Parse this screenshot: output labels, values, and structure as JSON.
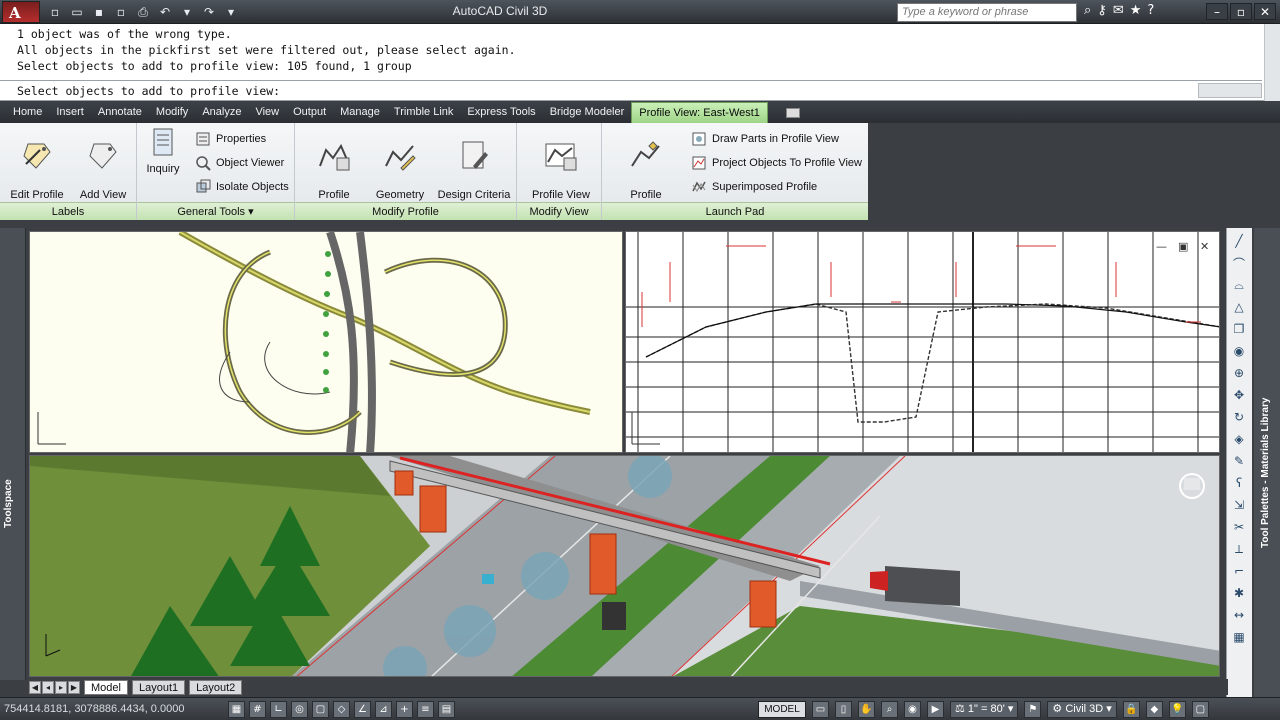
{
  "app": {
    "title": "AutoCAD Civil 3D",
    "logo_letter": "A",
    "search_placeholder": "Type a keyword or phrase"
  },
  "command_line": {
    "history": [
      "1 object was of the wrong type.",
      "All objects in the pickfirst set were filtered out, please select again.",
      "Select objects to add to profile view: 105 found, 1 group"
    ],
    "prompt": "Select objects to add to profile view:"
  },
  "ribbon": {
    "tabs": [
      "Home",
      "Insert",
      "Annotate",
      "Modify",
      "Analyze",
      "View",
      "Output",
      "Manage",
      "Trimble Link",
      "Express Tools",
      "Bridge Modeler",
      "Profile View: East-West1"
    ],
    "active_tab": "Profile View: East-West1",
    "panels": {
      "labels": {
        "title": "Labels",
        "edit_profile_labels": "Edit Profile\nLabels",
        "add_view_labels": "Add View\nLabels"
      },
      "general_tools": {
        "title": "General Tools",
        "inquiry": "Inquiry",
        "properties": "Properties",
        "object_viewer": "Object Viewer",
        "isolate_objects": "Isolate Objects"
      },
      "modify_profile": {
        "title": "Modify Profile",
        "profile_properties": "Profile\nProperties",
        "geometry_editor": "Geometry\nEditor",
        "design_criteria_editor": "Design Criteria\nEditor"
      },
      "modify_view": {
        "title": "Modify View",
        "profile_view_properties": "Profile View\nProperties"
      },
      "launch_pad": {
        "title": "Launch Pad",
        "profile_creation_tools": "Profile\nCreation Tools",
        "draw_parts": "Draw Parts in Profile View",
        "project_objects": "Project Objects To Profile View",
        "superimposed_profile": "Superimposed Profile"
      }
    }
  },
  "side_panels": {
    "toolspace": "Toolspace",
    "palettes": "Tool Palettes - Materials Library"
  },
  "layout_tabs": [
    "Model",
    "Layout1",
    "Layout2"
  ],
  "active_layout": "Model",
  "status_bar": {
    "coordinates": "754414.8181, 3078886.4434, 0.0000",
    "space": "MODEL",
    "scale": "1\" = 80'",
    "workspace": "Civil 3D"
  },
  "colors": {
    "ribbon_active_tab": "#b6e3a0",
    "titlebar": "#3a3f45",
    "plan_background": "#fefef0",
    "bridge_pier": "#e05a2a"
  },
  "icons": [
    "search-icon",
    "star-icon",
    "help-icon",
    "gear-icon"
  ]
}
